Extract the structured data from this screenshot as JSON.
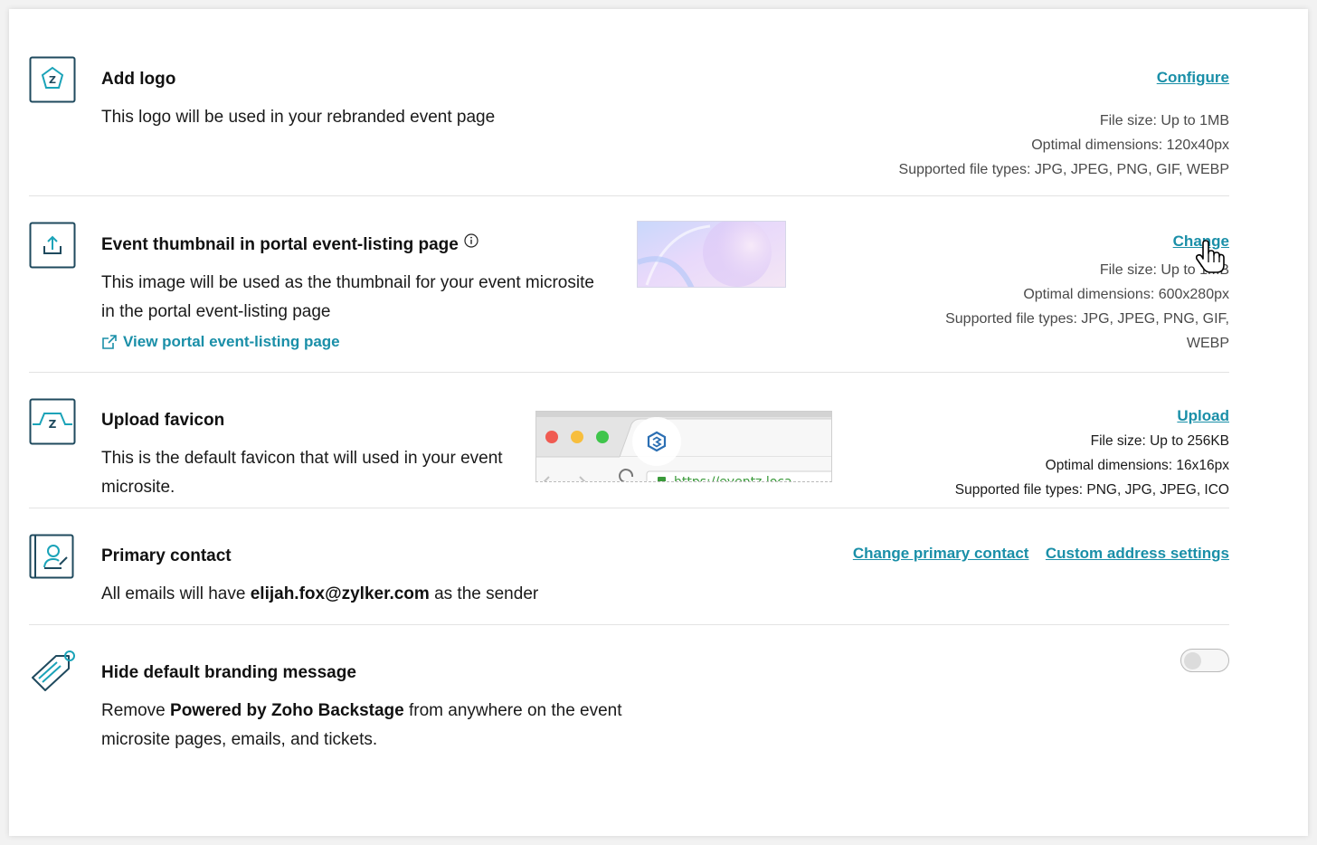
{
  "add_logo": {
    "title": "Add logo",
    "description": "This logo will be used in your rebranded event page",
    "action_label": "Configure",
    "file_size": "File size: Up to 1MB",
    "dimensions": "Optimal dimensions: 120x40px",
    "file_types": "Supported file types: JPG, JPEG, PNG, GIF, WEBP"
  },
  "event_thumbnail": {
    "title": "Event thumbnail in portal event-listing page",
    "description_line1": "This image will be used as the thumbnail for your event microsite",
    "description_line2": "in the portal event-listing page",
    "view_link": "View portal event-listing page",
    "action_label": "Change",
    "file_size": "File size: Up to 1MB",
    "dimensions": "Optimal dimensions: 600x280px",
    "file_types_line1": "Supported file types: JPG, JPEG, PNG, GIF,",
    "file_types_line2": "WEBP"
  },
  "favicon": {
    "title": "Upload favicon",
    "description_line1": "This is the default favicon that will used in your event",
    "description_line2": "microsite.",
    "browser_url": "https://eventz.loca",
    "action_label": "Upload",
    "file_size": "File size: Up to 256KB",
    "dimensions": "Optimal dimensions: 16x16px",
    "file_types": "Supported file types: PNG, JPG, JPEG, ICO"
  },
  "primary_contact": {
    "title": "Primary contact",
    "description_prefix": "All emails will have ",
    "email": "elijah.fox@zylker.com",
    "description_suffix": " as the sender",
    "change_label": "Change primary contact",
    "custom_address_label": "Custom address settings"
  },
  "branding": {
    "title": "Hide default branding message",
    "description_prefix": "Remove ",
    "powered_by": "Powered by Zoho Backstage",
    "description_suffix_line1": " from anywhere on the event",
    "description_line2": "microsite pages, emails, and tickets.",
    "toggle_on": false
  },
  "colors": {
    "accent": "#1a8fa8",
    "icon_stroke": "#1f4a5e",
    "icon_teal": "#1aa3b8"
  }
}
